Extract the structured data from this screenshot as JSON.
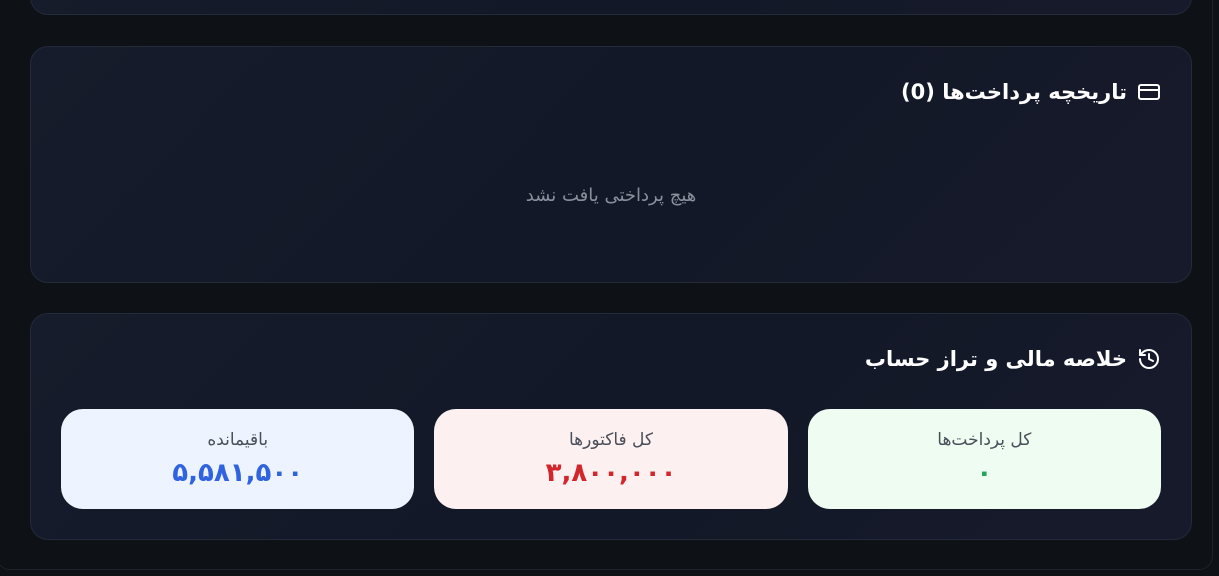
{
  "payments_history": {
    "title": "تاریخچه پرداخت‌ها (0)",
    "icon": "credit-card-icon",
    "empty_message": "هیچ پرداختی یافت نشد"
  },
  "summary": {
    "title": "خلاصه مالی و تراز حساب",
    "icon": "history-icon",
    "stats": [
      {
        "label": "کل پرداخت‌ها",
        "value": "۰",
        "color": "#22a55a",
        "bg": "#effcf2"
      },
      {
        "label": "کل فاکتورها",
        "value": "۳,۸۰۰,۰۰۰",
        "color": "#d1262c",
        "bg": "#fdf0f0"
      },
      {
        "label": "باقیمانده",
        "value": "۵,۵۸۱,۵۰۰",
        "color": "#2f63e0",
        "bg": "#eef4ff"
      }
    ]
  }
}
